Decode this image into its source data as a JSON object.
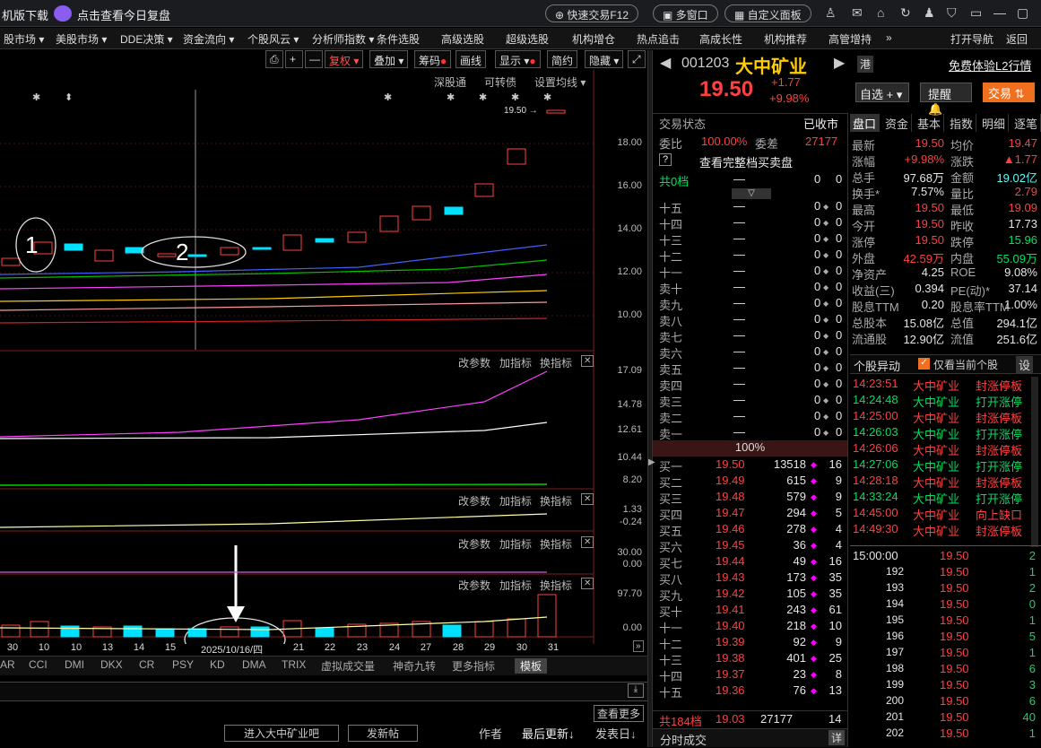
{
  "topbar": {
    "download": "机版下载",
    "replay": "点击查看今日复盘",
    "quick_trade": "快速交易F12",
    "multi_window": "多窗口",
    "custom_panel": "自定义面板"
  },
  "menu": [
    "股市场",
    "美股市场",
    "DDE决策",
    "资金流向",
    "个股风云",
    "分析师指数",
    "条件选股",
    "高级选股",
    "超级选股",
    "机构增仓",
    "热点追击",
    "高成长性",
    "机构推荐",
    "高管增持"
  ],
  "menu_more": "»",
  "open_nav": "打开导航",
  "back": "返回",
  "chart_toolbar": {
    "fuquan": "复权",
    "diejia": "叠加",
    "chouma": "筹码",
    "huaxian": "画线",
    "xianshi": "显示",
    "jianyue": "简约",
    "yincang": "隐藏"
  },
  "chart_links": {
    "shenzhen": "深股通",
    "convertible": "可转债",
    "set_ma": "设置均线"
  },
  "price_marker": "19.50",
  "main_yaxis": [
    "18.00",
    "16.00",
    "14.00",
    "12.00",
    "10.00"
  ],
  "annotations": {
    "circle1": "1",
    "circle2": "2"
  },
  "panel_ctrl": {
    "param": "改参数",
    "add": "加指标",
    "swap": "换指标",
    "close": "✕"
  },
  "panel2_yaxis": [
    "17.09",
    "14.78",
    "12.61",
    "10.44",
    "8.20"
  ],
  "panel3_yaxis": [
    "1.33",
    "-0.24"
  ],
  "panel4_yaxis": [
    "30.00",
    "0.00"
  ],
  "panel5_yaxis": [
    "97.70",
    "0.00"
  ],
  "x_labels": [
    "30",
    "10",
    "10",
    "13",
    "14",
    "15",
    "",
    "",
    "21",
    "22",
    "23",
    "24",
    "27",
    "28",
    "29",
    "30",
    "31"
  ],
  "x_highlight": "2025/10/16/四",
  "indicators": [
    "AR",
    "CCI",
    "DMI",
    "DKX",
    "CR",
    "PSY",
    "KD",
    "DMA",
    "TRIX",
    "虚拟成交量",
    "神奇九转",
    "更多指标"
  ],
  "indicator_active": "模板",
  "bottom": {
    "more": "查看更多",
    "enter_forum": "进入大中矿业吧",
    "post": "发新帖",
    "author": "作者",
    "last_update": "最后更新",
    "post_date": "发表日"
  },
  "stock": {
    "code": "001203",
    "name": "大中矿业",
    "price": "19.50",
    "change": "+1.77",
    "pct": "+9.98%",
    "hk": "港",
    "l2": "免费体验L2行情",
    "zixuan": "自选",
    "tixing": "提醒",
    "jiaoyi": "交易"
  },
  "status": {
    "label": "交易状态",
    "value": "已收市"
  },
  "weibi": {
    "l1": "委比",
    "v1": "100.00%",
    "l2": "委差",
    "v2": "27177"
  },
  "full_book": "查看完整档买卖盘",
  "total0": {
    "label": "共0档",
    "a": "—",
    "b": "0",
    "c": "0"
  },
  "asks": [
    {
      "l": "十五",
      "p": "—",
      "v": "0",
      "n": "0"
    },
    {
      "l": "十四",
      "p": "—",
      "v": "0",
      "n": "0"
    },
    {
      "l": "十三",
      "p": "—",
      "v": "0",
      "n": "0"
    },
    {
      "l": "十二",
      "p": "—",
      "v": "0",
      "n": "0"
    },
    {
      "l": "十一",
      "p": "—",
      "v": "0",
      "n": "0"
    },
    {
      "l": "卖十",
      "p": "—",
      "v": "0",
      "n": "0"
    },
    {
      "l": "卖九",
      "p": "—",
      "v": "0",
      "n": "0"
    },
    {
      "l": "卖八",
      "p": "—",
      "v": "0",
      "n": "0"
    },
    {
      "l": "卖七",
      "p": "—",
      "v": "0",
      "n": "0"
    },
    {
      "l": "卖六",
      "p": "—",
      "v": "0",
      "n": "0"
    },
    {
      "l": "卖五",
      "p": "—",
      "v": "0",
      "n": "0"
    },
    {
      "l": "卖四",
      "p": "—",
      "v": "0",
      "n": "0"
    },
    {
      "l": "卖三",
      "p": "—",
      "v": "0",
      "n": "0"
    },
    {
      "l": "卖二",
      "p": "—",
      "v": "0",
      "n": "0"
    },
    {
      "l": "卖一",
      "p": "—",
      "v": "0",
      "n": "0"
    }
  ],
  "mid_pct": "100%",
  "bids": [
    {
      "l": "买一",
      "p": "19.50",
      "v": "13518",
      "n": "16"
    },
    {
      "l": "买二",
      "p": "19.49",
      "v": "615",
      "n": "9"
    },
    {
      "l": "买三",
      "p": "19.48",
      "v": "579",
      "n": "9"
    },
    {
      "l": "买四",
      "p": "19.47",
      "v": "294",
      "n": "5"
    },
    {
      "l": "买五",
      "p": "19.46",
      "v": "278",
      "n": "4"
    },
    {
      "l": "买六",
      "p": "19.45",
      "v": "36",
      "n": "4"
    },
    {
      "l": "买七",
      "p": "19.44",
      "v": "49",
      "n": "16"
    },
    {
      "l": "买八",
      "p": "19.43",
      "v": "173",
      "n": "35"
    },
    {
      "l": "买九",
      "p": "19.42",
      "v": "105",
      "n": "35"
    },
    {
      "l": "买十",
      "p": "19.41",
      "v": "243",
      "n": "61"
    },
    {
      "l": "十一",
      "p": "19.40",
      "v": "218",
      "n": "10"
    },
    {
      "l": "十二",
      "p": "19.39",
      "v": "92",
      "n": "9"
    },
    {
      "l": "十三",
      "p": "19.38",
      "v": "401",
      "n": "25"
    },
    {
      "l": "十四",
      "p": "19.37",
      "v": "23",
      "n": "8"
    },
    {
      "l": "十五",
      "p": "19.36",
      "v": "76",
      "n": "13"
    }
  ],
  "bid_total": {
    "label": "共184档",
    "p": "19.03",
    "v": "27177",
    "n": "14"
  },
  "fenshi": "分时成交",
  "detail": "详",
  "tabs": [
    "盘口",
    "资金",
    "基本",
    "指数",
    "明细",
    "逐笔"
  ],
  "quote": [
    {
      "a": "最新",
      "av": "19.50",
      "b": "均价",
      "bv": "19.47"
    },
    {
      "a": "涨幅",
      "av": "+9.98%",
      "b": "涨跌",
      "bv": "▲1.77"
    },
    {
      "a": "总手",
      "av": "97.68万",
      "b": "金额",
      "bv": "19.02亿"
    },
    {
      "a": "换手*",
      "av": "7.57%",
      "b": "量比",
      "bv": "2.79"
    },
    {
      "a": "最高",
      "av": "19.50",
      "b": "最低",
      "bv": "19.09"
    },
    {
      "a": "今开",
      "av": "19.50",
      "b": "昨收",
      "bv": "17.73"
    },
    {
      "a": "涨停",
      "av": "19.50",
      "b": "跌停",
      "bv": "15.96"
    },
    {
      "a": "外盘",
      "av": "42.59万",
      "b": "内盘",
      "bv": "55.09万"
    },
    {
      "a": "净资产",
      "av": "4.25",
      "b": "ROE",
      "bv": "9.08%"
    },
    {
      "a": "收益(三)",
      "av": "0.394",
      "b": "PE(动)*",
      "bv": "37.14"
    },
    {
      "a": "股息TTM",
      "av": "0.20",
      "b": "股息率TTM",
      "bv": "1.00%"
    },
    {
      "a": "总股本",
      "av": "15.08亿",
      "b": "总值",
      "bv": "294.1亿"
    },
    {
      "a": "流通股",
      "av": "12.90亿",
      "b": "流值",
      "bv": "251.6亿"
    }
  ],
  "events_hdr": {
    "title": "个股异动",
    "check": "仅看当前个股",
    "set": "设"
  },
  "events": [
    {
      "t": "14:23:51",
      "n": "大中矿业",
      "e": "封涨停板",
      "c": "red"
    },
    {
      "t": "14:24:48",
      "n": "大中矿业",
      "e": "打开涨停",
      "c": "green"
    },
    {
      "t": "14:25:00",
      "n": "大中矿业",
      "e": "封涨停板",
      "c": "red"
    },
    {
      "t": "14:26:03",
      "n": "大中矿业",
      "e": "打开涨停",
      "c": "green"
    },
    {
      "t": "14:26:06",
      "n": "大中矿业",
      "e": "封涨停板",
      "c": "red"
    },
    {
      "t": "14:27:06",
      "n": "大中矿业",
      "e": "打开涨停",
      "c": "green"
    },
    {
      "t": "14:28:18",
      "n": "大中矿业",
      "e": "封涨停板",
      "c": "red"
    },
    {
      "t": "14:33:24",
      "n": "大中矿业",
      "e": "打开涨停",
      "c": "green"
    },
    {
      "t": "14:45:00",
      "n": "大中矿业",
      "e": "向上缺口",
      "c": "red"
    },
    {
      "t": "14:49:30",
      "n": "大中矿业",
      "e": "封涨停板",
      "c": "red"
    }
  ],
  "ticks": [
    {
      "t": "15:00:00",
      "p": "19.50",
      "v": "2"
    },
    {
      "t": "192",
      "p": "19.50",
      "v": "1"
    },
    {
      "t": "193",
      "p": "19.50",
      "v": "2"
    },
    {
      "t": "194",
      "p": "19.50",
      "v": "0"
    },
    {
      "t": "195",
      "p": "19.50",
      "v": "1"
    },
    {
      "t": "196",
      "p": "19.50",
      "v": "5"
    },
    {
      "t": "197",
      "p": "19.50",
      "v": "1"
    },
    {
      "t": "198",
      "p": "19.50",
      "v": "6"
    },
    {
      "t": "199",
      "p": "19.50",
      "v": "3"
    },
    {
      "t": "200",
      "p": "19.50",
      "v": "6"
    },
    {
      "t": "201",
      "p": "19.50",
      "v": "40"
    },
    {
      "t": "202",
      "p": "19.50",
      "v": "1"
    }
  ],
  "colors": {
    "up": "#ff4040",
    "down": "#00e0ff",
    "ma5": "#ffffff",
    "ma10": "#ffcc00",
    "ma20": "#ff40ff",
    "ma30": "#00c000",
    "ma60": "#4060ff"
  }
}
